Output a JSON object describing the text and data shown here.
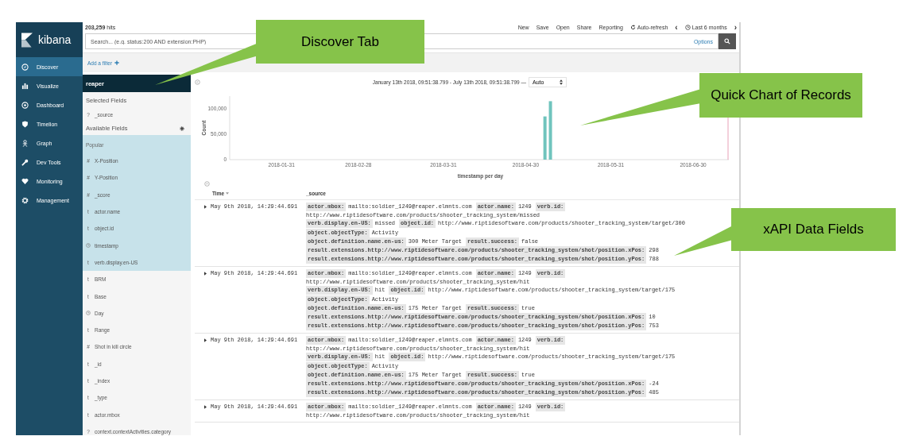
{
  "logo": {
    "text": "kibana"
  },
  "nav": [
    {
      "label": "Discover",
      "selected": true
    },
    {
      "label": "Visualize",
      "selected": false
    },
    {
      "label": "Dashboard",
      "selected": false
    },
    {
      "label": "Timelion",
      "selected": false
    },
    {
      "label": "Graph",
      "selected": false
    },
    {
      "label": "Dev Tools",
      "selected": false
    },
    {
      "label": "Monitoring",
      "selected": false
    },
    {
      "label": "Management",
      "selected": false
    }
  ],
  "hits": {
    "count": "203,259",
    "label": "hits"
  },
  "menu": [
    {
      "kind": "link",
      "label": "New"
    },
    {
      "kind": "link",
      "label": "Save"
    },
    {
      "kind": "link",
      "label": "Open"
    },
    {
      "kind": "link",
      "label": "Share"
    },
    {
      "kind": "link",
      "label": "Reporting"
    },
    {
      "kind": "refresh",
      "label": "Auto-refresh"
    },
    {
      "kind": "prev",
      "label": "‹"
    },
    {
      "kind": "time",
      "label": "Last 6 months"
    },
    {
      "kind": "next",
      "label": "›"
    }
  ],
  "search": {
    "placeholder": "Search... (e.g. status:200 AND extension:PHP)",
    "options": "Options"
  },
  "filter_bar": {
    "add_filter": "Add a filter"
  },
  "fields": {
    "index_pattern": "reaper",
    "selected_header": "Selected Fields",
    "selected": [
      {
        "kind": "glyph",
        "glyph": "?",
        "name": "_source"
      }
    ],
    "available_header": "Available Fields",
    "popular_header": "Popular",
    "popular": [
      {
        "kind": "glyph",
        "glyph": "#",
        "name": "X-Position"
      },
      {
        "kind": "glyph",
        "glyph": "#",
        "name": "Y-Position"
      },
      {
        "kind": "glyph",
        "glyph": "#",
        "name": "_score"
      },
      {
        "kind": "glyph",
        "glyph": "t",
        "name": "actor.name"
      },
      {
        "kind": "glyph",
        "glyph": "t",
        "name": "object.id"
      },
      {
        "kind": "date",
        "name": "timestamp"
      },
      {
        "kind": "glyph",
        "glyph": "t",
        "name": "verb.display.en-US"
      }
    ],
    "other": [
      {
        "kind": "glyph",
        "glyph": "t",
        "name": "BRM"
      },
      {
        "kind": "glyph",
        "glyph": "t",
        "name": "Base"
      },
      {
        "kind": "date",
        "name": "Day"
      },
      {
        "kind": "glyph",
        "glyph": "t",
        "name": "Range"
      },
      {
        "kind": "glyph",
        "glyph": "#",
        "name": "Shot in kill circle"
      },
      {
        "kind": "glyph",
        "glyph": "t",
        "name": "_id"
      },
      {
        "kind": "glyph",
        "glyph": "t",
        "name": "_index"
      },
      {
        "kind": "glyph",
        "glyph": "t",
        "name": "_type"
      },
      {
        "kind": "glyph",
        "glyph": "t",
        "name": "actor.mbox"
      },
      {
        "kind": "glyph",
        "glyph": "?",
        "name": "context.contextActivities.category"
      }
    ]
  },
  "chart": {
    "time_range": "January 13th 2018, 09:51:38.799 - July 13th 2018, 09:51:38.799 —",
    "interval": "Auto",
    "chart_data": {
      "type": "bar",
      "xlabel": "timestamp per day",
      "ylabel": "Count",
      "x": [
        "2018-05-07",
        "2018-05-09"
      ],
      "values": [
        85000,
        115000
      ],
      "xlim": [
        "2018-01-13",
        "2018-07-13"
      ],
      "ylim": [
        0,
        125000
      ],
      "xticks": [
        "2018-01-31",
        "2018-02-28",
        "2018-03-31",
        "2018-04-30",
        "2018-05-31",
        "2018-06-30"
      ],
      "yticks": [
        {
          "value": 0,
          "label": "0"
        },
        {
          "value": 50000,
          "label": "50,000"
        },
        {
          "value": 100000,
          "label": "100,000"
        }
      ]
    }
  },
  "table": {
    "columns": [
      "Time",
      "_source"
    ],
    "rows": [
      {
        "time": "May 9th 2018, 14:29:44.691",
        "lines": [
          [
            {
              "key": "actor.mbox:",
              "value": "mailto:soldier_1249@reaper.elmnts.com"
            },
            {
              "key": "actor.name:",
              "value": "1249"
            },
            {
              "key": "verb.id:",
              "value": "http://www.riptidesoftware.com/products/shooter_tracking_system/missed"
            }
          ],
          [
            {
              "key": "verb.display.en-US:",
              "value": "missed"
            },
            {
              "key": "object.id:",
              "value": "http://www.riptidesoftware.com/products/shooter_tracking_system/target/300"
            },
            {
              "key": "object.objectType:",
              "value": "Activity"
            }
          ],
          [
            {
              "key": "object.definition.name.en-us:",
              "value": "300 Meter Target"
            },
            {
              "key": "result.success:",
              "value": "false"
            }
          ],
          [
            {
              "key": "result.extensions.http://www.riptidesoftware.com/products/shooter_tracking_system/shot/position.xPos:",
              "value": "298"
            }
          ],
          [
            {
              "key": "result.extensions.http://www.riptidesoftware.com/products/shooter_tracking_system/shot/position.yPos:",
              "value": "788"
            }
          ]
        ]
      },
      {
        "time": "May 9th 2018, 14:29:44.691",
        "lines": [
          [
            {
              "key": "actor.mbox:",
              "value": "mailto:soldier_1249@reaper.elmnts.com"
            },
            {
              "key": "actor.name:",
              "value": "1249"
            },
            {
              "key": "verb.id:",
              "value": "http://www.riptidesoftware.com/products/shooter_tracking_system/hit"
            }
          ],
          [
            {
              "key": "verb.display.en-US:",
              "value": "hit"
            },
            {
              "key": "object.id:",
              "value": "http://www.riptidesoftware.com/products/shooter_tracking_system/target/175"
            },
            {
              "key": "object.objectType:",
              "value": "Activity"
            }
          ],
          [
            {
              "key": "object.definition.name.en-us:",
              "value": "175 Meter Target"
            },
            {
              "key": "result.success:",
              "value": "true"
            }
          ],
          [
            {
              "key": "result.extensions.http://www.riptidesoftware.com/products/shooter_tracking_system/shot/position.xPos:",
              "value": "10"
            }
          ],
          [
            {
              "key": "result.extensions.http://www.riptidesoftware.com/products/shooter_tracking_system/shot/position.yPos:",
              "value": "753"
            }
          ]
        ]
      },
      {
        "time": "May 9th 2018, 14:29:44.691",
        "lines": [
          [
            {
              "key": "actor.mbox:",
              "value": "mailto:soldier_1249@reaper.elmnts.com"
            },
            {
              "key": "actor.name:",
              "value": "1249"
            },
            {
              "key": "verb.id:",
              "value": "http://www.riptidesoftware.com/products/shooter_tracking_system/hit"
            }
          ],
          [
            {
              "key": "verb.display.en-US:",
              "value": "hit"
            },
            {
              "key": "object.id:",
              "value": "http://www.riptidesoftware.com/products/shooter_tracking_system/target/175"
            },
            {
              "key": "object.objectType:",
              "value": "Activity"
            }
          ],
          [
            {
              "key": "object.definition.name.en-us:",
              "value": "175 Meter Target"
            },
            {
              "key": "result.success:",
              "value": "true"
            }
          ],
          [
            {
              "key": "result.extensions.http://www.riptidesoftware.com/products/shooter_tracking_system/shot/position.xPos:",
              "value": "-24"
            }
          ],
          [
            {
              "key": "result.extensions.http://www.riptidesoftware.com/products/shooter_tracking_system/shot/position.yPos:",
              "value": "485"
            }
          ]
        ]
      },
      {
        "time": "May 9th 2018, 14:29:44.691",
        "lines": [
          [
            {
              "key": "actor.mbox:",
              "value": "mailto:soldier_1249@reaper.elmnts.com"
            },
            {
              "key": "actor.name:",
              "value": "1249"
            },
            {
              "key": "verb.id:",
              "value": "http://www.riptidesoftware.com/products/shooter_tracking_system/hit"
            }
          ]
        ]
      }
    ]
  },
  "annotations": [
    {
      "text": "Discover Tab"
    },
    {
      "text": "Quick Chart of Records"
    },
    {
      "text": "xAPI Data Fields"
    }
  ]
}
